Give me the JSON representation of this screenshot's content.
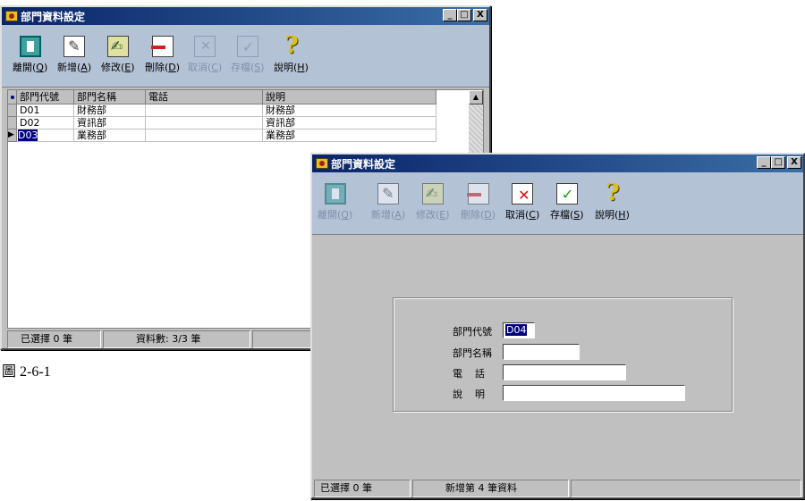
{
  "window1": {
    "title": "部門資料設定",
    "controls": [
      "_",
      "□",
      "X"
    ],
    "toolbar": [
      {
        "label": "離開(",
        "key": "Q",
        "icon": "exit-door-icon",
        "enabled": true
      },
      {
        "label": "新增(",
        "key": "A",
        "icon": "new-document-icon",
        "enabled": true
      },
      {
        "label": "修改(",
        "key": "E",
        "icon": "edit-document-icon",
        "enabled": true
      },
      {
        "label": "刪除(",
        "key": "D",
        "icon": "delete-document-icon",
        "enabled": true
      },
      {
        "label": "取消(",
        "key": "C",
        "icon": "cancel-icon",
        "enabled": false
      },
      {
        "label": "存檔(",
        "key": "S",
        "icon": "save-icon",
        "enabled": false
      },
      {
        "label": "說明(",
        "key": "H",
        "icon": "help-icon",
        "enabled": true
      }
    ],
    "grid": {
      "columns": [
        "部門代號",
        "部門名稱",
        "電話",
        "說明"
      ],
      "rows": [
        [
          "D01",
          "財務部",
          "",
          "財務部"
        ],
        [
          "D02",
          "資訊部",
          "",
          "資訊部"
        ],
        [
          "D03",
          "業務部",
          "",
          "業務部"
        ]
      ],
      "current_row_marker": "▶"
    },
    "status": {
      "selected": "已選擇 0 筆",
      "count": "資料數: 3/3 筆"
    }
  },
  "caption": "圖 2-6-1",
  "window2": {
    "title": "部門資料設定",
    "controls": [
      "_",
      "□",
      "X"
    ],
    "toolbar": [
      {
        "label": "離開(",
        "key": "Q",
        "icon": "exit-door-icon",
        "enabled": false
      },
      {
        "label": "新增(",
        "key": "A",
        "icon": "new-document-icon",
        "enabled": false
      },
      {
        "label": "修改(",
        "key": "E",
        "icon": "edit-document-icon",
        "enabled": false
      },
      {
        "label": "刪除(",
        "key": "D",
        "icon": "delete-document-icon",
        "enabled": false
      },
      {
        "label": "取消(",
        "key": "C",
        "icon": "cancel-icon",
        "enabled": true
      },
      {
        "label": "存檔(",
        "key": "S",
        "icon": "save-icon",
        "enabled": true
      },
      {
        "label": "說明(",
        "key": "H",
        "icon": "help-icon",
        "enabled": true
      }
    ],
    "form": {
      "code_label": "部門代號",
      "code_value": "D04",
      "name_label": "部門名稱",
      "name_value": "",
      "phone_label": "電    話",
      "phone_value": "",
      "desc_label": "說    明",
      "desc_value": ""
    },
    "status": {
      "selected": "已選擇 0 筆",
      "mode": "新增第 4 筆資料"
    }
  }
}
